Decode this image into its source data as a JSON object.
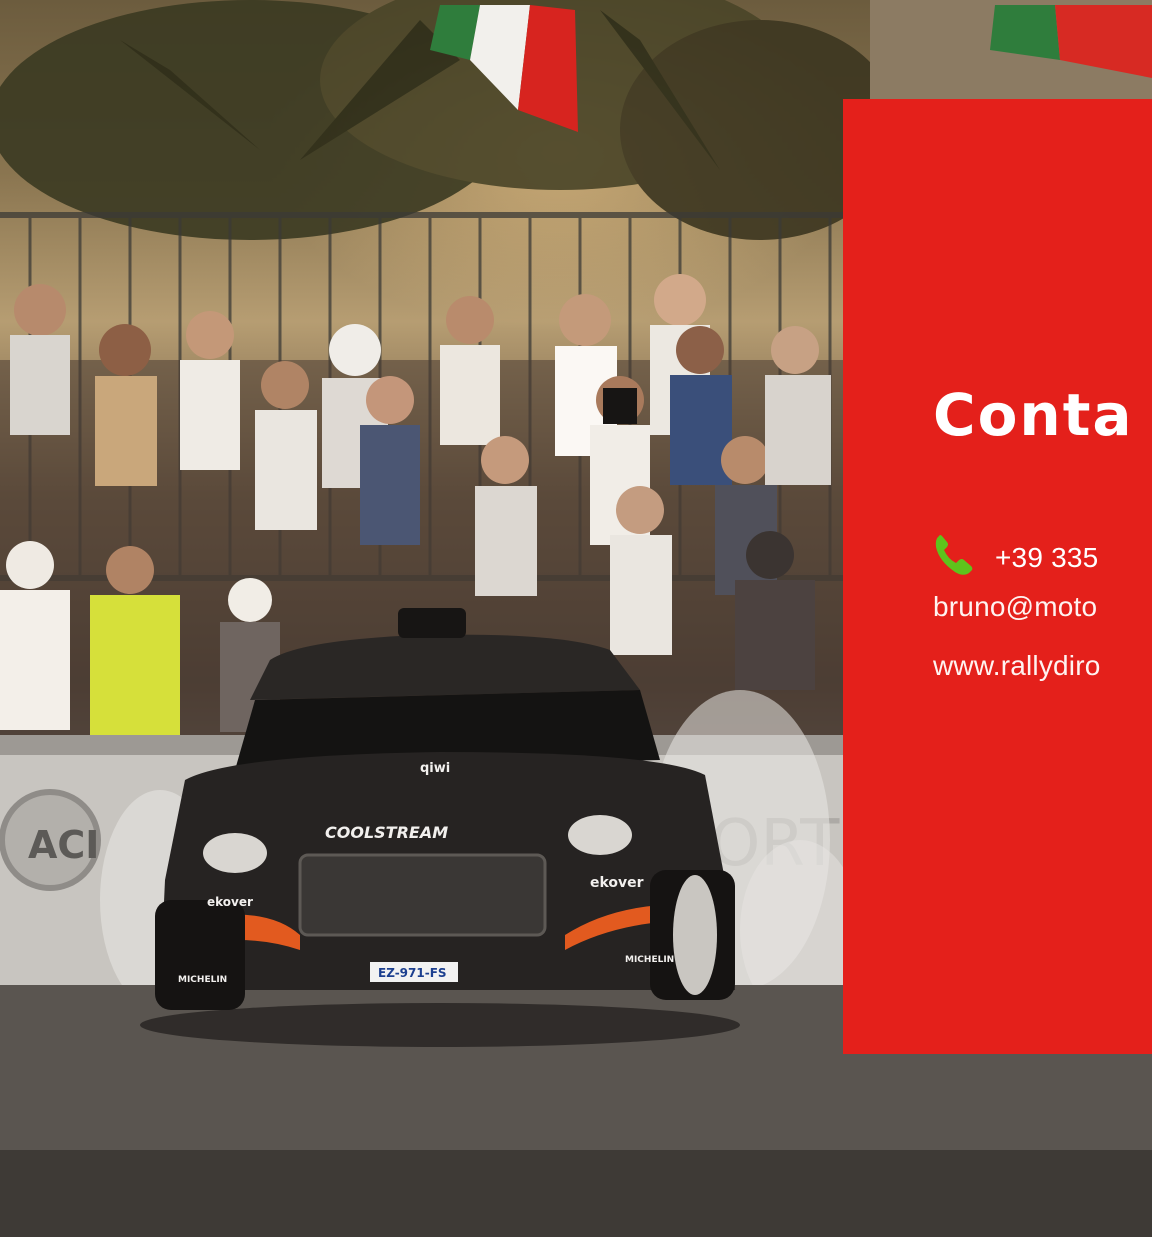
{
  "hero": {
    "image_subject": "rally-car-crowd-photo",
    "car_livery": [
      "COOLSTREAM",
      "ekover",
      "MICHELIN",
      "qiwi"
    ],
    "plate": "EZ-971-FS",
    "banner_logo": "ACI"
  },
  "contact": {
    "title": "Conta",
    "phone": "+39 335",
    "email": "bruno@moto",
    "website": "www.rallydiro",
    "phone_icon": "phone-icon",
    "background_color": "#e4201b",
    "phone_icon_color": "#5ec31c",
    "text_color": "#ffffff"
  }
}
